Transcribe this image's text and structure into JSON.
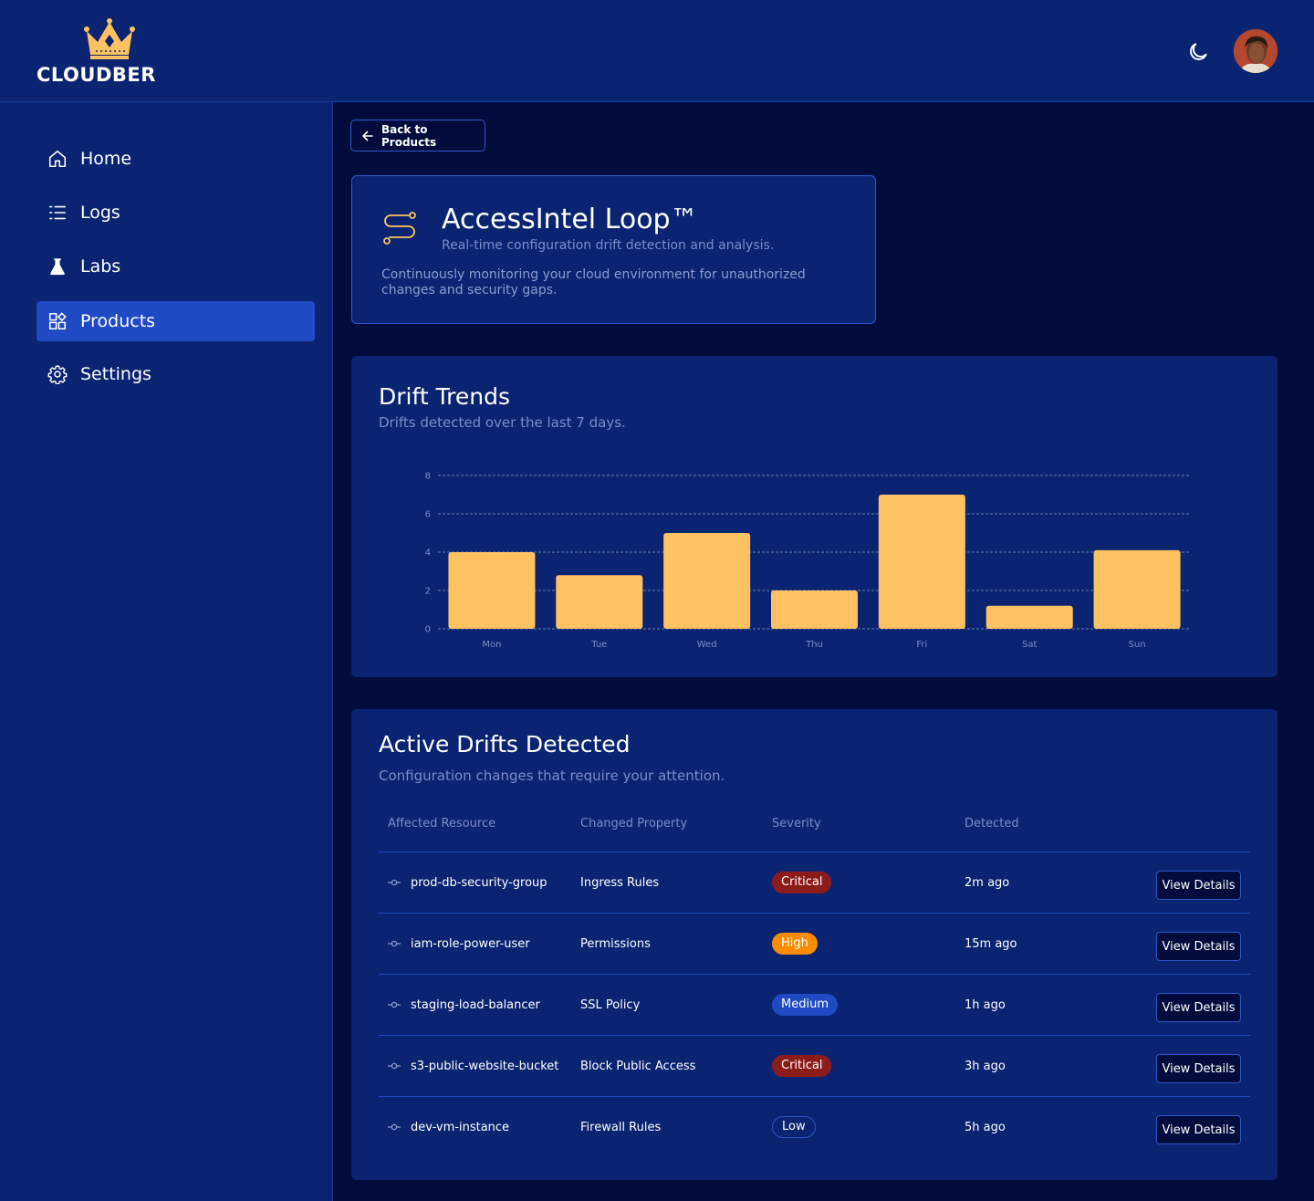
{
  "brand": {
    "name": "CLOUDBER",
    "crown_color": "#ffc262"
  },
  "header": {
    "theme_icon": "moon-icon",
    "avatar_alt": "user-avatar"
  },
  "sidebar": {
    "items": [
      {
        "label": "Home",
        "icon": "home-icon",
        "active": false
      },
      {
        "label": "Logs",
        "icon": "list-icon",
        "active": false
      },
      {
        "label": "Labs",
        "icon": "flask-icon",
        "active": false
      },
      {
        "label": "Products",
        "icon": "grid-icon",
        "active": true
      },
      {
        "label": "Settings",
        "icon": "gear-icon",
        "active": false
      }
    ]
  },
  "back_button": {
    "label": "Back to Products"
  },
  "product": {
    "title": "AccessIntel Loop™",
    "subtitle": "Real-time configuration drift detection and analysis.",
    "description": "Continuously monitoring your cloud environment for unauthorized changes and security gaps."
  },
  "drift_trends": {
    "title": "Drift Trends",
    "subtitle": "Drifts detected over the last 7 days."
  },
  "chart_data": {
    "type": "bar",
    "categories": [
      "Mon",
      "Tue",
      "Wed",
      "Thu",
      "Fri",
      "Sat",
      "Sun"
    ],
    "values": [
      4,
      2.8,
      5,
      2,
      7,
      1.2,
      4.1
    ],
    "yticks": [
      0,
      2,
      4,
      6,
      8
    ],
    "ylim": [
      0,
      8
    ],
    "grid": true,
    "bar_color": "#ffc262",
    "title": "",
    "xlabel": "",
    "ylabel": ""
  },
  "active_drifts": {
    "title": "Active Drifts Detected",
    "subtitle": "Configuration changes that require your attention.",
    "columns": [
      "Affected Resource",
      "Changed Property",
      "Severity",
      "Detected"
    ],
    "rows": [
      {
        "resource": "prod-db-security-group",
        "property": "Ingress Rules",
        "severity": "Critical",
        "severity_class": "critical",
        "detected": "2m ago",
        "action": "View Details"
      },
      {
        "resource": "iam-role-power-user",
        "property": "Permissions",
        "severity": "High",
        "severity_class": "high",
        "detected": "15m ago",
        "action": "View Details"
      },
      {
        "resource": "staging-load-balancer",
        "property": "SSL Policy",
        "severity": "Medium",
        "severity_class": "medium",
        "detected": "1h ago",
        "action": "View Details"
      },
      {
        "resource": "s3-public-website-bucket",
        "property": "Block Public Access",
        "severity": "Critical",
        "severity_class": "critical",
        "detected": "3h ago",
        "action": "View Details"
      },
      {
        "resource": "dev-vm-instance",
        "property": "Firewall Rules",
        "severity": "Low",
        "severity_class": "low",
        "detected": "5h ago",
        "action": "View Details"
      }
    ]
  }
}
